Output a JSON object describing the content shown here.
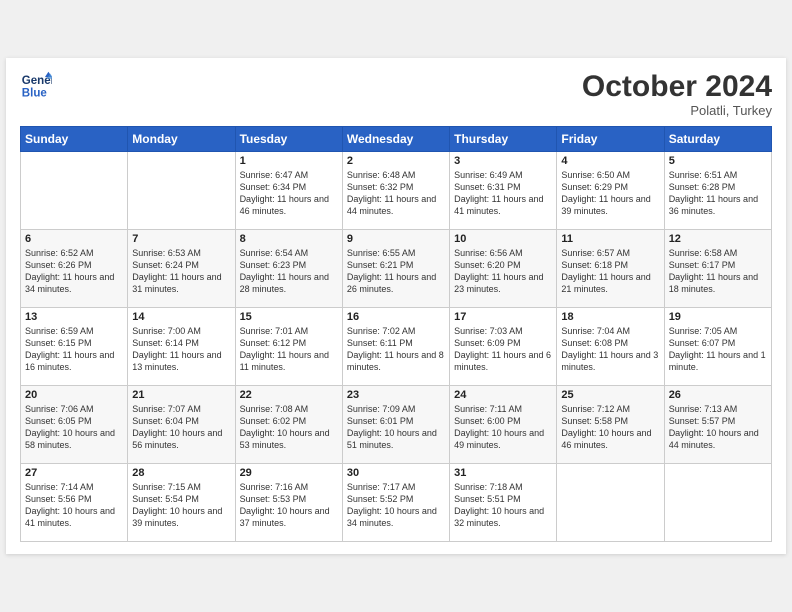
{
  "header": {
    "logo_line1": "General",
    "logo_line2": "Blue",
    "month_title": "October 2024",
    "location": "Polatli, Turkey"
  },
  "weekdays": [
    "Sunday",
    "Monday",
    "Tuesday",
    "Wednesday",
    "Thursday",
    "Friday",
    "Saturday"
  ],
  "weeks": [
    [
      {
        "day": "",
        "content": ""
      },
      {
        "day": "",
        "content": ""
      },
      {
        "day": "1",
        "content": "Sunrise: 6:47 AM\nSunset: 6:34 PM\nDaylight: 11 hours and 46 minutes."
      },
      {
        "day": "2",
        "content": "Sunrise: 6:48 AM\nSunset: 6:32 PM\nDaylight: 11 hours and 44 minutes."
      },
      {
        "day": "3",
        "content": "Sunrise: 6:49 AM\nSunset: 6:31 PM\nDaylight: 11 hours and 41 minutes."
      },
      {
        "day": "4",
        "content": "Sunrise: 6:50 AM\nSunset: 6:29 PM\nDaylight: 11 hours and 39 minutes."
      },
      {
        "day": "5",
        "content": "Sunrise: 6:51 AM\nSunset: 6:28 PM\nDaylight: 11 hours and 36 minutes."
      }
    ],
    [
      {
        "day": "6",
        "content": "Sunrise: 6:52 AM\nSunset: 6:26 PM\nDaylight: 11 hours and 34 minutes."
      },
      {
        "day": "7",
        "content": "Sunrise: 6:53 AM\nSunset: 6:24 PM\nDaylight: 11 hours and 31 minutes."
      },
      {
        "day": "8",
        "content": "Sunrise: 6:54 AM\nSunset: 6:23 PM\nDaylight: 11 hours and 28 minutes."
      },
      {
        "day": "9",
        "content": "Sunrise: 6:55 AM\nSunset: 6:21 PM\nDaylight: 11 hours and 26 minutes."
      },
      {
        "day": "10",
        "content": "Sunrise: 6:56 AM\nSunset: 6:20 PM\nDaylight: 11 hours and 23 minutes."
      },
      {
        "day": "11",
        "content": "Sunrise: 6:57 AM\nSunset: 6:18 PM\nDaylight: 11 hours and 21 minutes."
      },
      {
        "day": "12",
        "content": "Sunrise: 6:58 AM\nSunset: 6:17 PM\nDaylight: 11 hours and 18 minutes."
      }
    ],
    [
      {
        "day": "13",
        "content": "Sunrise: 6:59 AM\nSunset: 6:15 PM\nDaylight: 11 hours and 16 minutes."
      },
      {
        "day": "14",
        "content": "Sunrise: 7:00 AM\nSunset: 6:14 PM\nDaylight: 11 hours and 13 minutes."
      },
      {
        "day": "15",
        "content": "Sunrise: 7:01 AM\nSunset: 6:12 PM\nDaylight: 11 hours and 11 minutes."
      },
      {
        "day": "16",
        "content": "Sunrise: 7:02 AM\nSunset: 6:11 PM\nDaylight: 11 hours and 8 minutes."
      },
      {
        "day": "17",
        "content": "Sunrise: 7:03 AM\nSunset: 6:09 PM\nDaylight: 11 hours and 6 minutes."
      },
      {
        "day": "18",
        "content": "Sunrise: 7:04 AM\nSunset: 6:08 PM\nDaylight: 11 hours and 3 minutes."
      },
      {
        "day": "19",
        "content": "Sunrise: 7:05 AM\nSunset: 6:07 PM\nDaylight: 11 hours and 1 minute."
      }
    ],
    [
      {
        "day": "20",
        "content": "Sunrise: 7:06 AM\nSunset: 6:05 PM\nDaylight: 10 hours and 58 minutes."
      },
      {
        "day": "21",
        "content": "Sunrise: 7:07 AM\nSunset: 6:04 PM\nDaylight: 10 hours and 56 minutes."
      },
      {
        "day": "22",
        "content": "Sunrise: 7:08 AM\nSunset: 6:02 PM\nDaylight: 10 hours and 53 minutes."
      },
      {
        "day": "23",
        "content": "Sunrise: 7:09 AM\nSunset: 6:01 PM\nDaylight: 10 hours and 51 minutes."
      },
      {
        "day": "24",
        "content": "Sunrise: 7:11 AM\nSunset: 6:00 PM\nDaylight: 10 hours and 49 minutes."
      },
      {
        "day": "25",
        "content": "Sunrise: 7:12 AM\nSunset: 5:58 PM\nDaylight: 10 hours and 46 minutes."
      },
      {
        "day": "26",
        "content": "Sunrise: 7:13 AM\nSunset: 5:57 PM\nDaylight: 10 hours and 44 minutes."
      }
    ],
    [
      {
        "day": "27",
        "content": "Sunrise: 7:14 AM\nSunset: 5:56 PM\nDaylight: 10 hours and 41 minutes."
      },
      {
        "day": "28",
        "content": "Sunrise: 7:15 AM\nSunset: 5:54 PM\nDaylight: 10 hours and 39 minutes."
      },
      {
        "day": "29",
        "content": "Sunrise: 7:16 AM\nSunset: 5:53 PM\nDaylight: 10 hours and 37 minutes."
      },
      {
        "day": "30",
        "content": "Sunrise: 7:17 AM\nSunset: 5:52 PM\nDaylight: 10 hours and 34 minutes."
      },
      {
        "day": "31",
        "content": "Sunrise: 7:18 AM\nSunset: 5:51 PM\nDaylight: 10 hours and 32 minutes."
      },
      {
        "day": "",
        "content": ""
      },
      {
        "day": "",
        "content": ""
      }
    ]
  ]
}
